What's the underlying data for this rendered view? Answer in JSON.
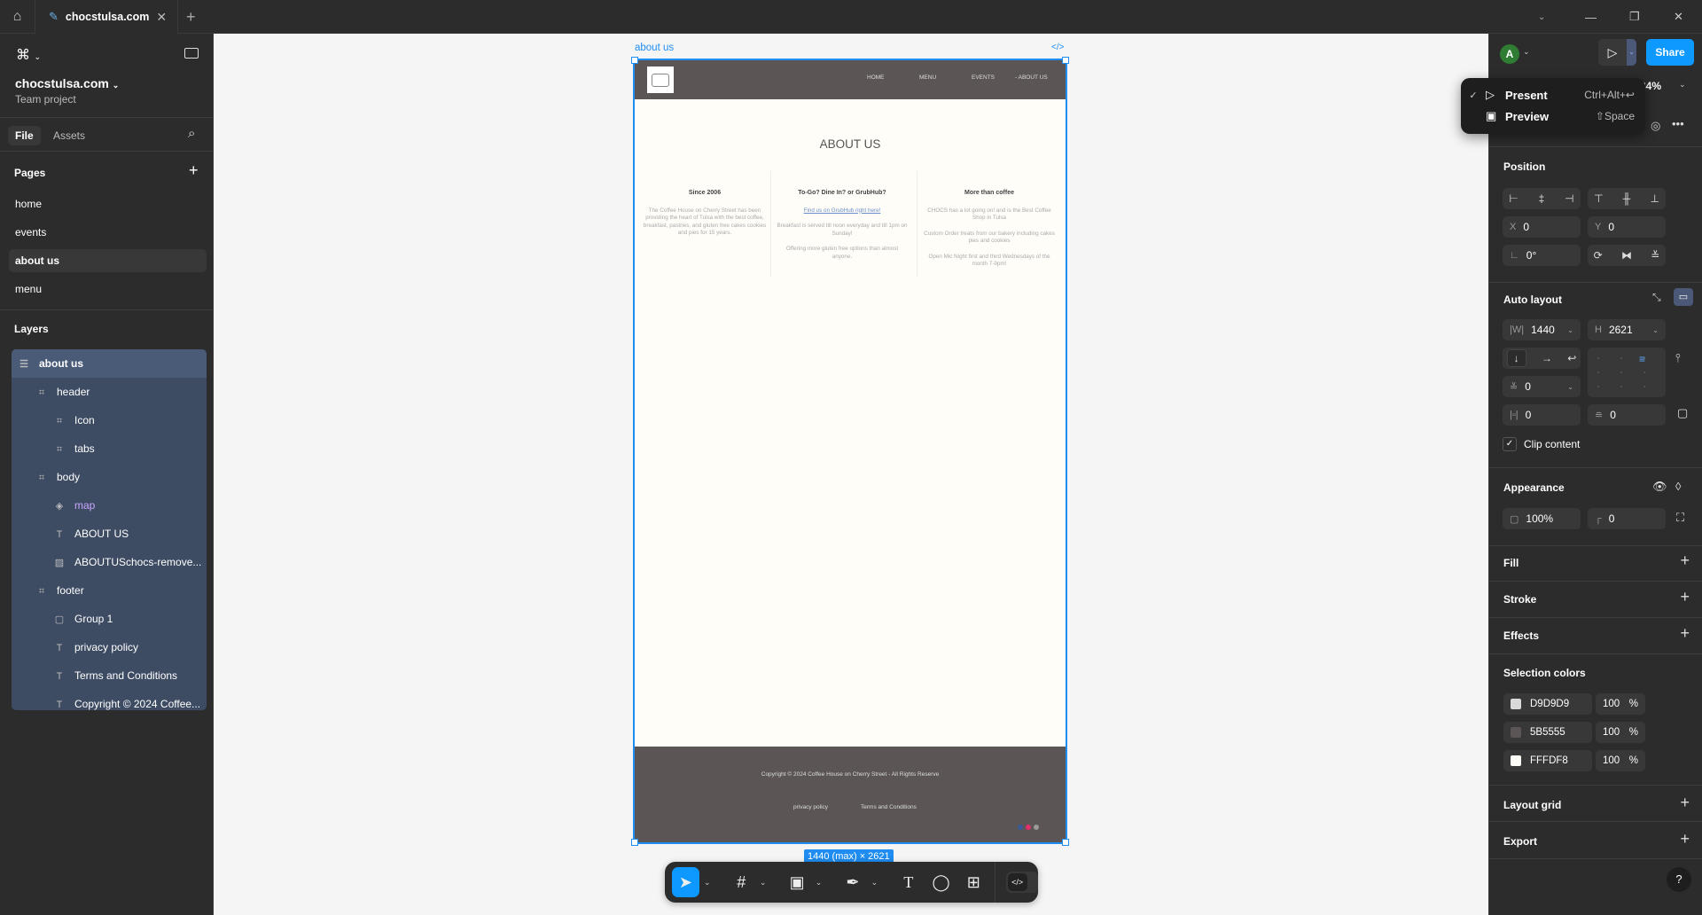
{
  "tabbar": {
    "home_icon": "home-icon",
    "tab_title": "chocstulsa.com",
    "file_icon": "pen-tool-icon"
  },
  "sidebar": {
    "project_name": "chocstulsa.com",
    "project_sub": "Team project",
    "tabs": [
      "File",
      "Assets"
    ],
    "pages_title": "Pages",
    "pages": [
      "home",
      "events",
      "about us",
      "menu"
    ],
    "selected_page": "about us",
    "layers_title": "Layers",
    "layers": [
      {
        "name": "about us",
        "icon": "auto-layout-frame-icon",
        "depth": 0
      },
      {
        "name": "header",
        "icon": "frame-icon",
        "depth": 1
      },
      {
        "name": "Icon",
        "icon": "frame-icon",
        "depth": 2
      },
      {
        "name": "tabs",
        "icon": "frame-icon",
        "depth": 2
      },
      {
        "name": "body",
        "icon": "frame-icon",
        "depth": 1
      },
      {
        "name": "map",
        "icon": "component-instance-icon",
        "depth": 2
      },
      {
        "name": "ABOUT US",
        "icon": "text-icon",
        "depth": 2
      },
      {
        "name": "ABOUTUSchocs-remove...",
        "icon": "image-icon",
        "depth": 2
      },
      {
        "name": "footer",
        "icon": "frame-icon",
        "depth": 1
      },
      {
        "name": "Group 1",
        "icon": "group-icon",
        "depth": 2
      },
      {
        "name": "privacy policy",
        "icon": "text-icon",
        "depth": 2
      },
      {
        "name": "Terms and Conditions",
        "icon": "text-icon",
        "depth": 2
      },
      {
        "name": "Copyright © 2024 Coffee...",
        "icon": "text-icon",
        "depth": 2
      }
    ]
  },
  "canvas": {
    "frame_label": "about us",
    "size_badge": "1440 (max) × 2621",
    "site": {
      "nav": [
        "HOME",
        "MENU",
        "EVENTS",
        "- ABOUT US"
      ],
      "title": "ABOUT US",
      "columns": [
        {
          "heading": "Since 2006",
          "paras": [
            "The Coffee House on Cherry Street has been providing the heart of Tulsa with the best coffee, breakfast, pastries, and gluten free cakes cookies and pies for 15 years."
          ]
        },
        {
          "heading": "To-Go? Dine In? or GrubHub?",
          "link": "Find us on GrubHub right here!",
          "paras": [
            "Breakfast is served till noon everyday and till 1pm on Sunday!",
            "Offering more gluten free options than almost anyone."
          ]
        },
        {
          "heading": "More than coffee",
          "paras": [
            "CHOCS has a lot going on! and is the Best Coffee Shop in Tulsa",
            "Custom Order treats from our bakery including cakes pies and cookies",
            "Open Mic Night first and third Wednesdays of the month 7-9pm!"
          ]
        }
      ],
      "footer": {
        "copyright": "Copyright © 2024 Coffee House on Cherry Street - All Rights Reserve",
        "links": [
          "privacy policy",
          "Terms and Conditions"
        ]
      }
    }
  },
  "toolbar": {
    "tools": [
      "move-icon",
      "frame-icon",
      "image-icon",
      "pen-icon",
      "text-icon",
      "comment-icon",
      "actions-icon",
      "dev-mode-icon"
    ]
  },
  "right": {
    "avatar": "A",
    "share": "Share",
    "zoom": "34%",
    "menu": [
      {
        "label": "Present",
        "shortcut": "Ctrl+Alt+↩",
        "checked": true
      },
      {
        "label": "Preview",
        "shortcut": "⇧Space",
        "checked": false
      }
    ],
    "position": {
      "title": "Position",
      "x": "0",
      "y": "0",
      "rotation": "0°"
    },
    "auto_layout": {
      "title": "Auto layout",
      "w": "1440",
      "h": "2621",
      "gap": "0",
      "pad_h": "0",
      "pad_v": "0",
      "clip": "Clip content",
      "clip_checked": true
    },
    "appearance": {
      "title": "Appearance",
      "opacity": "100%",
      "radius": "0"
    },
    "sections": [
      "Fill",
      "Stroke",
      "Effects"
    ],
    "selection_colors": {
      "title": "Selection colors",
      "colors": [
        {
          "hex": "D9D9D9",
          "opacity": "100"
        },
        {
          "hex": "5B5555",
          "opacity": "100"
        },
        {
          "hex": "FFFDF8",
          "opacity": "100"
        }
      ],
      "unit": "%"
    },
    "bottom_sections": [
      "Layout grid",
      "Export"
    ],
    "help": "?"
  },
  "colors": {
    "accent": "#0d99ff",
    "panel": "#2c2c2c",
    "site_header": "#5b5555",
    "site_bg": "#fffdf8"
  }
}
